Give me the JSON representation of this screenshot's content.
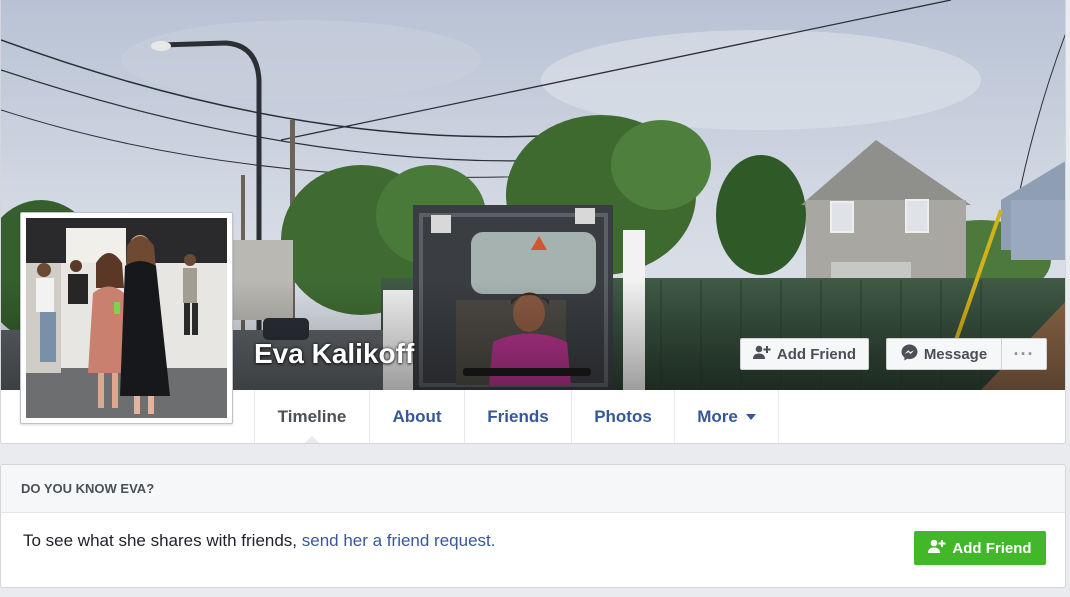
{
  "profile": {
    "name": "Eva Kalikoff"
  },
  "cover_actions": {
    "add_friend_label": "Add Friend",
    "message_label": "Message",
    "more_label": "···"
  },
  "nav": {
    "tabs": [
      {
        "label": "Timeline",
        "active": true
      },
      {
        "label": "About"
      },
      {
        "label": "Friends"
      },
      {
        "label": "Photos"
      },
      {
        "label": "More"
      }
    ]
  },
  "know_card": {
    "heading": "DO YOU KNOW EVA?",
    "body_text": "To see what she shares with friends, ",
    "link_text": "send her a friend request.",
    "button_label": "Add Friend"
  },
  "colors": {
    "link": "#365899",
    "green_button": "#42b72a",
    "page_bg": "#e9ebee"
  },
  "icons": {
    "add_friend": "add-friend-icon",
    "messenger": "messenger-icon",
    "caret": "caret-down-icon"
  }
}
